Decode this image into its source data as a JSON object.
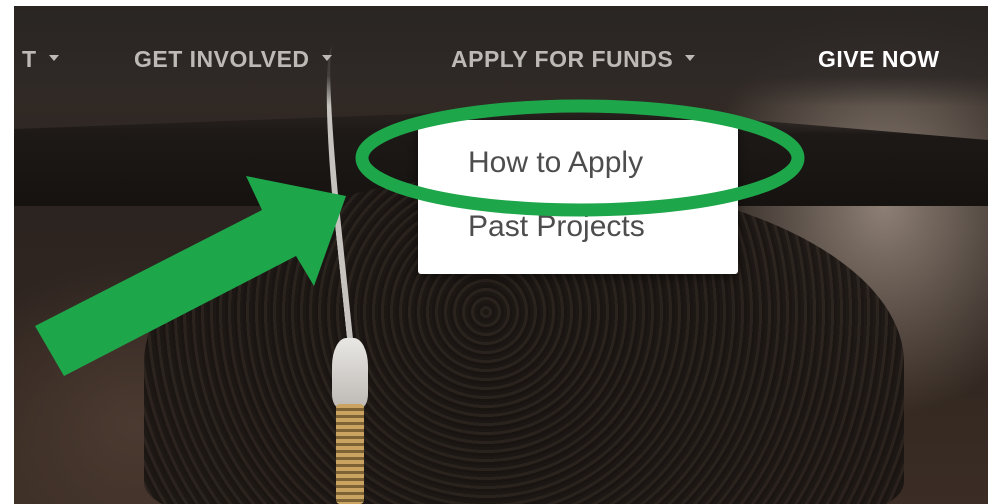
{
  "nav": {
    "items": [
      {
        "label": "T",
        "has_caret": true
      },
      {
        "label": "GET INVOLVED",
        "has_caret": true
      },
      {
        "label": "APPLY FOR FUNDS",
        "has_caret": true
      },
      {
        "label": "GIVE NOW",
        "has_caret": false
      }
    ]
  },
  "dropdown": {
    "items": [
      {
        "label": "How to Apply",
        "highlighted": true
      },
      {
        "label": "Past Projects",
        "highlighted": false
      }
    ]
  },
  "annotation": {
    "highlight_color": "#1ea64a",
    "arrow_color": "#1ea64a"
  },
  "icons": [
    "caret-down-icon",
    "green-arrow-annotation",
    "green-ellipse-annotation"
  ]
}
